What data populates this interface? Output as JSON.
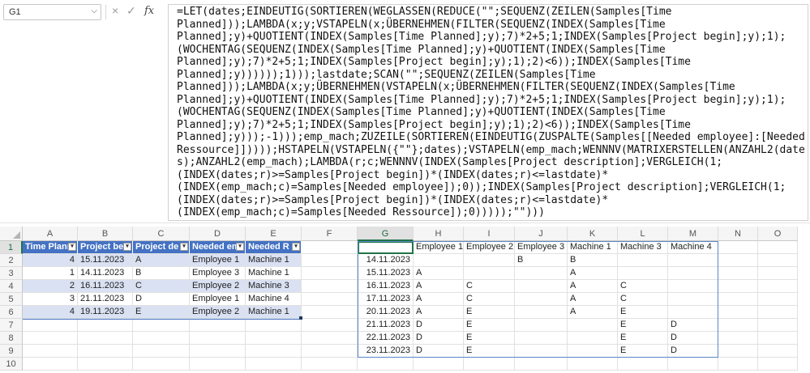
{
  "name_box": {
    "value": "G1"
  },
  "formula_bar": {
    "cancel": "×",
    "enter": "✓",
    "fx": "fx",
    "lines": [
      "=LET(dates;EINDEUTIG(SORTIEREN(WEGLASSEN(REDUCE(\"\";SEQUENZ(ZEILEN(Samples[Time",
      "Planned]));LAMBDA(x;y;VSTAPELN(x;ÜBERNEHMEN(FILTER(SEQUENZ(INDEX(Samples[Time",
      "Planned];y)+QUOTIENT(INDEX(Samples[Time Planned];y);7)*2+5;1;INDEX(Samples[Project begin];y);1);",
      "(WOCHENTAG(SEQUENZ(INDEX(Samples[Time Planned];y)+QUOTIENT(INDEX(Samples[Time",
      "Planned];y);7)*2+5;1;INDEX(Samples[Project begin];y);1);2)<6));INDEX(Samples[Time",
      "Planned];y))))));1)));lastdate;SCAN(\"\";SEQUENZ(ZEILEN(Samples[Time",
      "Planned]));LAMBDA(x;y;ÜBERNEHMEN(VSTAPELN(x;ÜBERNEHMEN(FILTER(SEQUENZ(INDEX(Samples[Time",
      "Planned];y)+QUOTIENT(INDEX(Samples[Time Planned];y);7)*2+5;1;INDEX(Samples[Project begin];y);1);",
      "(WOCHENTAG(SEQUENZ(INDEX(Samples[Time Planned];y)+QUOTIENT(INDEX(Samples[Time",
      "Planned];y);7)*2+5;1;INDEX(Samples[Project begin];y);1);2)<6));INDEX(Samples[Time",
      "Planned];y)));-1)));emp_mach;ZUZEILE(SORTIEREN(EINDEUTIG(ZUSPALTE(Samples[[Needed employee]:[Needed",
      "Ressource]]))));HSTAPELN(VSTAPELN({\"\"};dates);VSTAPELN(emp_mach;WENNNV(MATRIXERSTELLEN(ANZAHL2(date",
      "s);ANZAHL2(emp_mach);LAMBDA(r;c;WENNNV(INDEX(Samples[Project description];VERGLEICH(1;",
      "(INDEX(dates;r)>=Samples[Project begin])*(INDEX(dates;r)<=lastdate)*",
      "(INDEX(emp_mach;c)=Samples[Needed employee]);0));INDEX(Samples[Project description];VERGLEICH(1;",
      "(INDEX(dates;r)>=Samples[Project begin])*(INDEX(dates;r)<=lastdate)*",
      "(INDEX(emp_mach;c)=Samples[Needed Ressource]);0)))));\"\")))"
    ]
  },
  "columns": [
    "A",
    "B",
    "C",
    "D",
    "E",
    "F",
    "G",
    "H",
    "I",
    "J",
    "K",
    "L",
    "M",
    "N",
    "O"
  ],
  "rows": [
    "1",
    "2",
    "3",
    "4",
    "5",
    "6",
    "7",
    "8",
    "9",
    "10"
  ],
  "table": {
    "headers": [
      "Time Plann",
      "Project be",
      "Project de",
      "Needed em",
      "Needed R"
    ],
    "rows": [
      [
        "4",
        "15.11.2023",
        "A",
        "Employee 1",
        "Machine 1"
      ],
      [
        "1",
        "14.11.2023",
        "B",
        "Employee 3",
        "Machine 1"
      ],
      [
        "2",
        "16.11.2023",
        "C",
        "Employee 2",
        "Machine 3"
      ],
      [
        "3",
        "21.11.2023",
        "D",
        "Employee 1",
        "Machine 4"
      ],
      [
        "4",
        "19.11.2023",
        "E",
        "Employee 2",
        "Machine 1"
      ]
    ]
  },
  "spill": {
    "headers": [
      "",
      "Employee 1",
      "Employee 2",
      "Employee 3",
      "Machine 1",
      "Machine 3",
      "Machine 4"
    ],
    "rows": [
      [
        "14.11.2023",
        "",
        "",
        "B",
        "B",
        "",
        ""
      ],
      [
        "15.11.2023",
        "A",
        "",
        "",
        "A",
        "",
        ""
      ],
      [
        "16.11.2023",
        "A",
        "C",
        "",
        "A",
        "C",
        ""
      ],
      [
        "17.11.2023",
        "A",
        "C",
        "",
        "A",
        "C",
        ""
      ],
      [
        "20.11.2023",
        "A",
        "E",
        "",
        "A",
        "E",
        ""
      ],
      [
        "21.11.2023",
        "D",
        "E",
        "",
        "",
        "E",
        "D"
      ],
      [
        "22.11.2023",
        "D",
        "E",
        "",
        "",
        "E",
        "D"
      ],
      [
        "23.11.2023",
        "D",
        "E",
        "",
        "",
        "E",
        "D"
      ]
    ]
  },
  "colors": {
    "table_header": "#4472c4",
    "table_band": "#d9e1f2",
    "selection": "#217346",
    "spill_border": "#5b86c7"
  }
}
